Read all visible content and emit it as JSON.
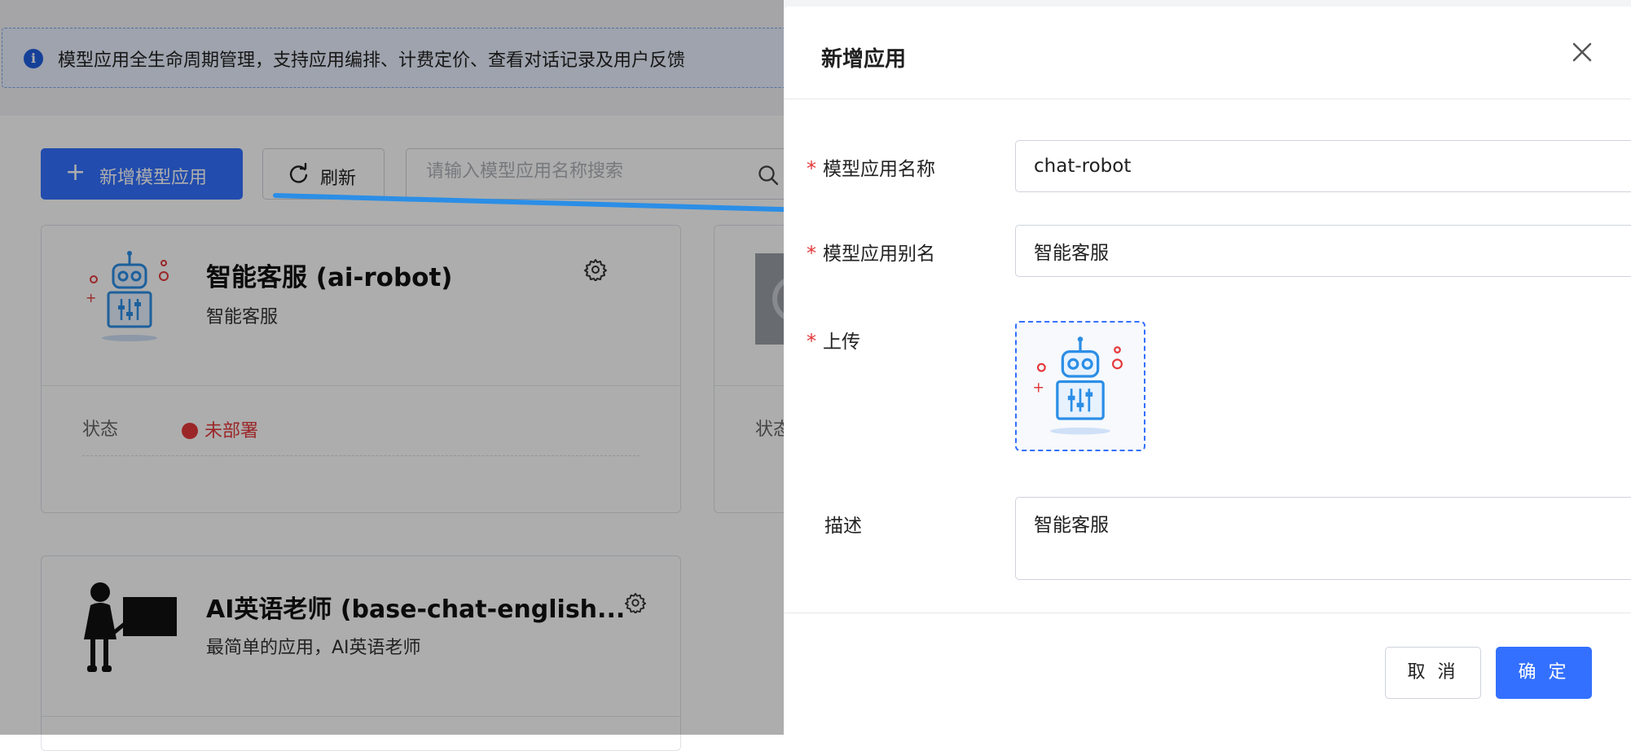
{
  "banner": {
    "text": "模型应用全生命周期管理，支持应用编排、计费定价、查看对话记录及用户反馈",
    "icon": "info-icon"
  },
  "toolbar": {
    "add_label": "新增模型应用",
    "refresh_label": "刷新",
    "search_placeholder": "请输入模型应用名称搜索"
  },
  "cards": [
    {
      "title": "智能客服 (ai-robot)",
      "subtitle": "智能客服",
      "status_label": "状态",
      "status_value": "未部署",
      "status_color": "#e5383b"
    },
    {
      "status_label": "状态"
    },
    {
      "title": "AI英语老师 (base-chat-english...",
      "subtitle": "最简单的应用，AI英语老师"
    }
  ],
  "drawer": {
    "title": "新增应用",
    "fields": {
      "name": {
        "label": "模型应用名称",
        "value": "chat-robot"
      },
      "alias": {
        "label": "模型应用别名",
        "value": "智能客服"
      },
      "upload": {
        "label": "上传"
      },
      "description": {
        "label": "描述",
        "value": "智能客服"
      }
    },
    "cancel_label": "取 消",
    "ok_label": "确 定"
  },
  "colors": {
    "accent": "#3370ff",
    "danger": "#e5383b",
    "arrow": "#2b8ee6"
  }
}
